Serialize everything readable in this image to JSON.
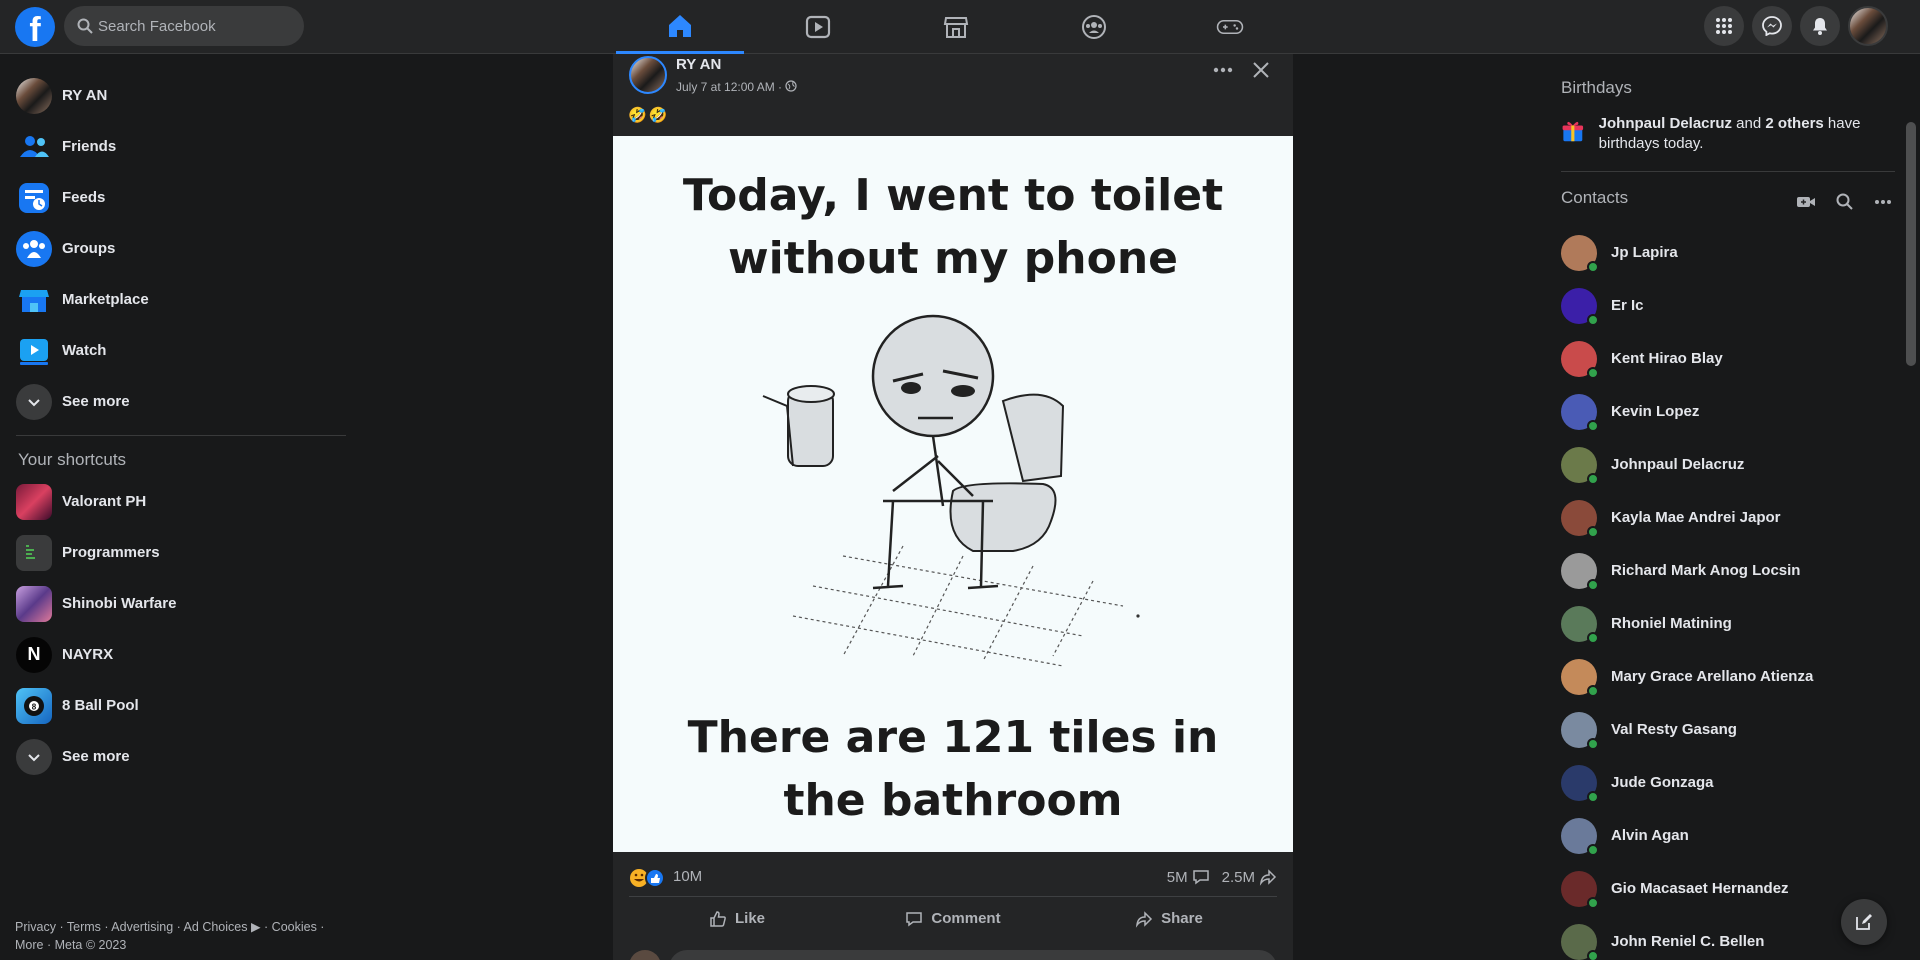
{
  "header": {
    "logo": "f",
    "search_placeholder": "Search Facebook",
    "nav_tabs": [
      {
        "name": "home",
        "icon": "home-icon",
        "active": true
      },
      {
        "name": "watch",
        "icon": "video-icon",
        "active": false
      },
      {
        "name": "marketplace",
        "icon": "store-icon",
        "active": false
      },
      {
        "name": "groups",
        "icon": "groups-icon",
        "active": false
      },
      {
        "name": "gaming",
        "icon": "gamepad-icon",
        "active": false
      }
    ],
    "right_buttons": [
      "menu-grid-icon",
      "messenger-icon",
      "bell-icon"
    ]
  },
  "left_sidebar": {
    "profile_name": "RY AN",
    "items": [
      {
        "label": "Friends",
        "icon": "friends-icon"
      },
      {
        "label": "Feeds",
        "icon": "feeds-icon"
      },
      {
        "label": "Groups",
        "icon": "groups-icon"
      },
      {
        "label": "Marketplace",
        "icon": "marketplace-icon"
      },
      {
        "label": "Watch",
        "icon": "watch-icon"
      }
    ],
    "see_more_1": "See more",
    "shortcuts_title": "Your shortcuts",
    "shortcuts": [
      {
        "label": "Valorant PH"
      },
      {
        "label": "Programmers"
      },
      {
        "label": "Shinobi Warfare"
      },
      {
        "label": "NAYRX"
      },
      {
        "label": "8 Ball Pool"
      }
    ],
    "nayrx_letter": "N",
    "see_more_2": "See more",
    "footer_line1": "Privacy · Terms · Advertising · Ad Choices ▶ · Cookies ·",
    "footer_line2": "More · Meta © 2023"
  },
  "post": {
    "author": "RY AN",
    "meta": "July 7 at 12:00 AM ·",
    "emoji": "🤣🤣",
    "meme_top_1": "Today, I went to toilet",
    "meme_top_2": "without my phone",
    "meme_bottom_1": "There are 121 tiles in",
    "meme_bottom_2": "the bathroom",
    "reactions_count": "10M",
    "comments_count": "5M",
    "shares_count": "2.5M",
    "actions": {
      "like": "Like",
      "comment": "Comment",
      "share": "Share"
    }
  },
  "right_sidebar": {
    "birthdays_title": "Birthdays",
    "birthday_name": "Johnpaul Delacruz",
    "birthday_and": " and ",
    "birthday_others": "2 others",
    "birthday_rest": " have birthdays today.",
    "contacts_title": "Contacts",
    "contacts": [
      {
        "name": "Jp Lapira",
        "color": "#b07a5a"
      },
      {
        "name": "Er Ic",
        "color": "#3b1fa8"
      },
      {
        "name": "Kent Hirao Blay",
        "color": "#c94b4b"
      },
      {
        "name": "Kevin Lopez",
        "color": "#4a5bb5"
      },
      {
        "name": "Johnpaul Delacruz",
        "color": "#6b7a4a"
      },
      {
        "name": "Kayla Mae Andrei Japor",
        "color": "#8a4a3a"
      },
      {
        "name": "Richard Mark Anog Locsin",
        "color": "#9a9a9a"
      },
      {
        "name": "Rhoniel Matining",
        "color": "#5a7a5a"
      },
      {
        "name": "Mary Grace Arellano Atienza",
        "color": "#c48a5a"
      },
      {
        "name": "Val Resty Gasang",
        "color": "#7a8aa0"
      },
      {
        "name": "Jude Gonzaga",
        "color": "#2a3a6a"
      },
      {
        "name": "Alvin Agan",
        "color": "#6a7a9a"
      },
      {
        "name": "Gio Macasaet Hernandez",
        "color": "#6a2a2a"
      },
      {
        "name": "John Reniel C. Bellen",
        "color": "#5a6a4a"
      }
    ]
  },
  "colors": {
    "accent": "#2d88ff",
    "brand": "#1877f2",
    "online": "#31a24c"
  }
}
